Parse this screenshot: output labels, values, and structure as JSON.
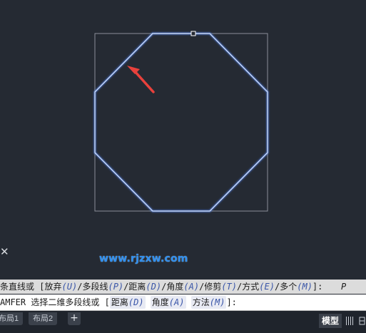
{
  "canvas": {
    "watermark": "www.rjzxw.com",
    "close_icon": "close-icon",
    "colors": {
      "background": "#252a33",
      "octagon_stroke": "#bcd8ff",
      "octagon_glow": "#5b8dff",
      "bounding_box": "#8a8f98",
      "arrow": "#e8413c"
    }
  },
  "command_history": {
    "prompt": "条直线或",
    "open_bracket": "[",
    "options": [
      {
        "label": "放弃",
        "key": "U"
      },
      {
        "label": "多段线",
        "key": "P"
      },
      {
        "label": "距离",
        "key": "D"
      },
      {
        "label": "角度",
        "key": "A"
      },
      {
        "label": "修剪",
        "key": "T"
      },
      {
        "label": "方式",
        "key": "E"
      },
      {
        "label": "多个",
        "key": "M"
      }
    ],
    "close_bracket": "]:",
    "answer": "P"
  },
  "command_line": {
    "prompt": "AMFER 选择二维多段线或",
    "open_bracket": "[",
    "options": [
      {
        "label": "距离",
        "key": "D"
      },
      {
        "label": "角度",
        "key": "A"
      },
      {
        "label": "方法",
        "key": "M"
      }
    ],
    "close_bracket": "]:"
  },
  "layout_tabs": {
    "tabs": [
      "布局1",
      "布局2"
    ],
    "add_label": "+"
  },
  "status_bar": {
    "model_label": "模型",
    "grid_icon": "grid-icon",
    "snap_icon": "snap-icon"
  }
}
